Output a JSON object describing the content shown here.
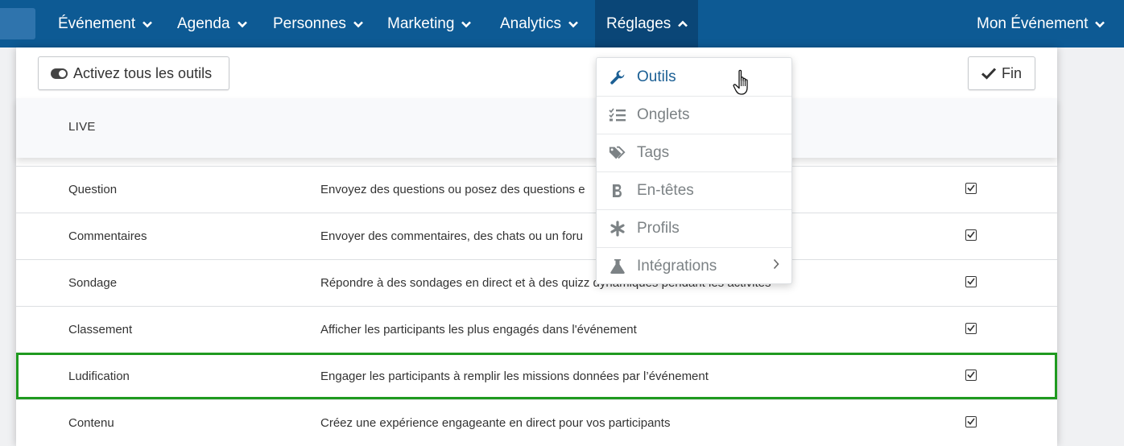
{
  "nav": {
    "items": [
      {
        "label": "Événement"
      },
      {
        "label": "Agenda"
      },
      {
        "label": "Personnes"
      },
      {
        "label": "Marketing"
      },
      {
        "label": "Analytics"
      },
      {
        "label": "Réglages"
      }
    ],
    "right_label": "Mon Événement"
  },
  "toolbar": {
    "activate_all_label": "Activez tous les outils",
    "done_label": "Fin"
  },
  "section": {
    "title": "LIVE"
  },
  "tools": [
    {
      "name": "Question",
      "description": "Envoyez des questions ou posez des questions e",
      "enabled": true
    },
    {
      "name": "Commentaires",
      "description": "Envoyer des commentaires, des chats ou un foru",
      "enabled": true
    },
    {
      "name": "Sondage",
      "description": "Répondre à des sondages en direct et à des quizz dynamiques pendant les activités",
      "enabled": true
    },
    {
      "name": "Classement",
      "description": "Afficher les participants les plus engagés dans l'événement",
      "enabled": true
    },
    {
      "name": "Ludification",
      "description": "Engager les participants à remplir les missions données par l’événement",
      "enabled": true
    },
    {
      "name": "Contenu",
      "description": "Créez une expérience engageante en direct pour vos participants",
      "enabled": true
    }
  ],
  "dropdown": {
    "items": [
      {
        "label": "Outils",
        "icon": "wrench-icon"
      },
      {
        "label": "Onglets",
        "icon": "checklist-icon"
      },
      {
        "label": "Tags",
        "icon": "tags-icon"
      },
      {
        "label": "En-têtes",
        "icon": "bold-icon"
      },
      {
        "label": "Profils",
        "icon": "asterisk-icon"
      },
      {
        "label": "Intégrations",
        "icon": "flask-icon"
      }
    ]
  },
  "colors": {
    "nav_bg": "#0d5a94",
    "nav_active": "#0a4677",
    "highlight": "#1f9a1f",
    "menu_active": "#1b5f94"
  }
}
